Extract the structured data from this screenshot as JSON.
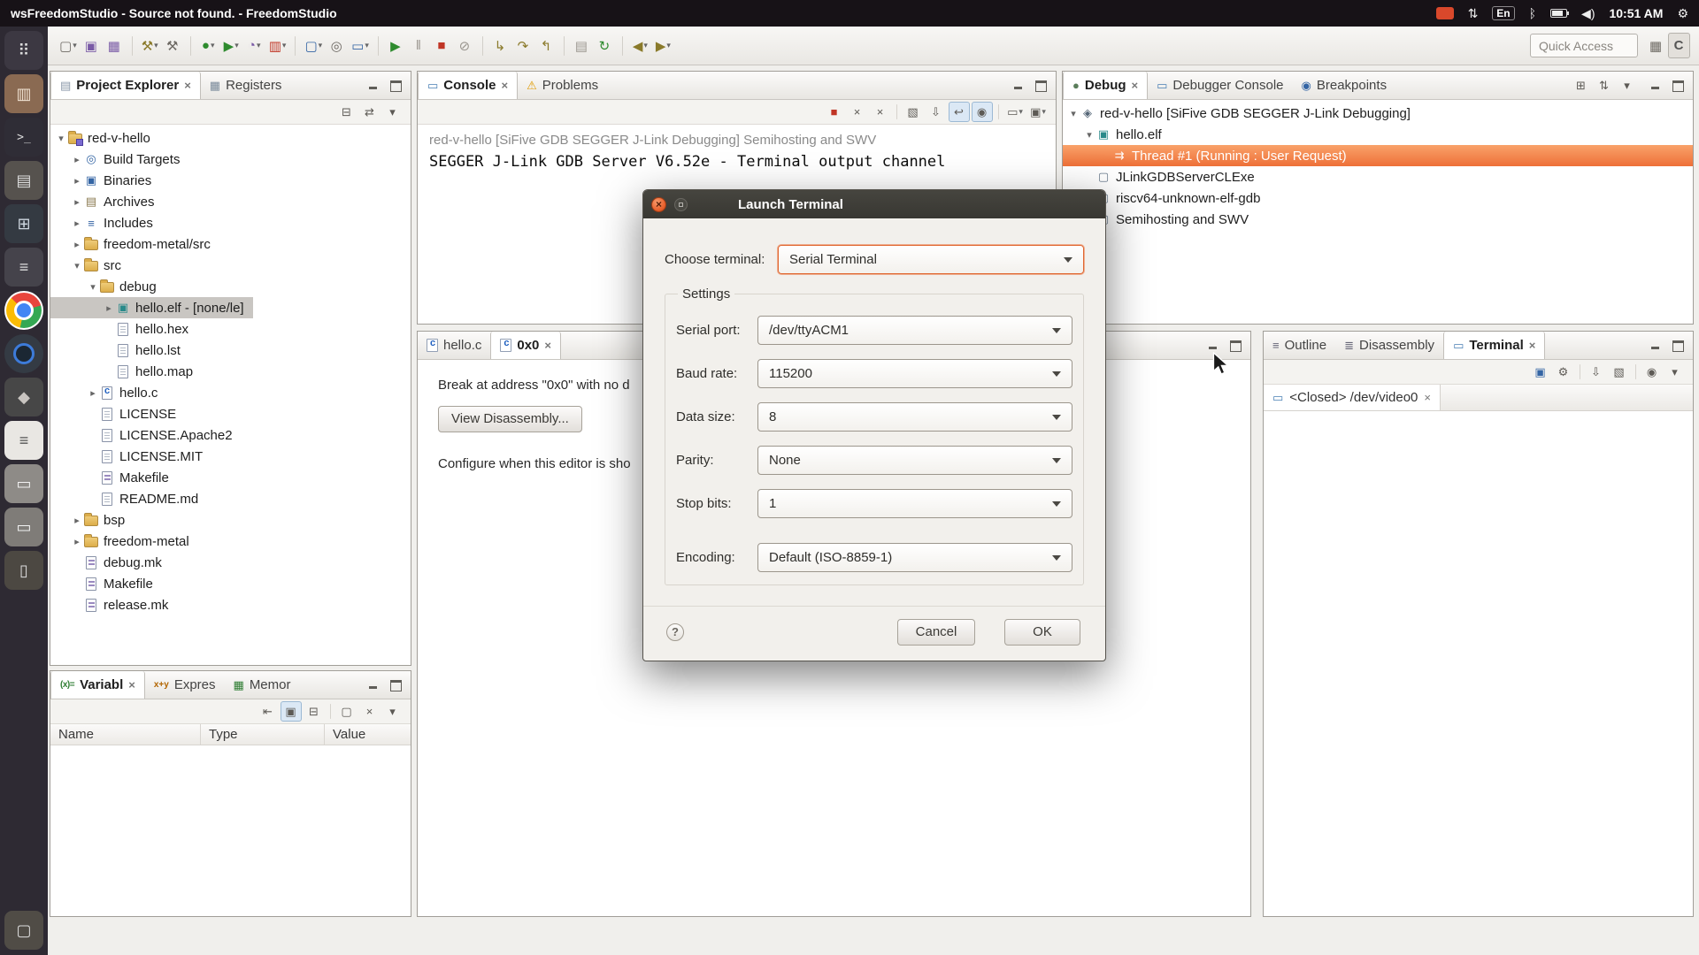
{
  "system_bar": {
    "title": "wsFreedomStudio - Source not found. - FreedomStudio",
    "language_indicator": "En",
    "time": "10:51 AM"
  },
  "dock": {
    "items": [
      {
        "name": "dash-icon",
        "glyph": "⠿",
        "mod": "dk-dash"
      },
      {
        "name": "files-icon",
        "glyph": "▥",
        "mod": "dk-files"
      },
      {
        "name": "terminal-icon",
        "glyph": ">_",
        "mod": "dk-term"
      },
      {
        "name": "archive-manager-icon",
        "glyph": "▤",
        "mod": "dk-arch"
      },
      {
        "name": "calculator-icon",
        "glyph": "⊞",
        "mod": "dk-calc"
      },
      {
        "name": "notes-icon",
        "glyph": "≡",
        "mod": "dk-note"
      },
      {
        "name": "chrome-icon",
        "glyph": "",
        "mod": "dk-chrome"
      },
      {
        "name": "camera-icon",
        "glyph": "",
        "mod": "dk-cam"
      },
      {
        "name": "gimp-icon",
        "glyph": "◆",
        "mod": "dk-gimp"
      },
      {
        "name": "freedomstudio-icon",
        "glyph": "≡",
        "mod": "dk-fs"
      },
      {
        "name": "drawer-icon",
        "glyph": "▭",
        "mod": "dk-gray1"
      },
      {
        "name": "drawer2-icon",
        "glyph": "▭",
        "mod": "dk-gray2"
      },
      {
        "name": "tablet-icon",
        "glyph": "▯",
        "mod": "dk-tab"
      },
      {
        "name": "trash-icon",
        "glyph": "▢",
        "mod": "dk-bottom"
      }
    ]
  },
  "toolbar": {
    "quick_access_label": "Quick Access",
    "buttons": [
      {
        "name": "new-button",
        "glyph": "▢",
        "dd": "▾",
        "mod": "c-gray"
      },
      {
        "name": "save-button",
        "glyph": "▣",
        "dd": "",
        "mod": "c-purple"
      },
      {
        "name": "save-all-button",
        "glyph": "▦",
        "dd": "",
        "mod": "c-purple"
      },
      {
        "mod": "sep"
      },
      {
        "name": "build-button",
        "glyph": "⚒",
        "dd": "▾",
        "mod": "c-olive"
      },
      {
        "name": "clean-build-button",
        "glyph": "⚒",
        "dd": "",
        "mod": "c-gray"
      },
      {
        "mod": "sep"
      },
      {
        "name": "debug-button",
        "glyph": "●",
        "dd": "▾",
        "mod": "c-green"
      },
      {
        "name": "run-button",
        "glyph": "▶",
        "dd": "▾",
        "mod": "c-green"
      },
      {
        "name": "profile-button",
        "glyph": "◔",
        "dd": "▾",
        "mod": "c-purple"
      },
      {
        "name": "coverage-button",
        "glyph": "▥",
        "dd": "▾",
        "mod": "c-red"
      },
      {
        "mod": "sep"
      },
      {
        "name": "new-c-file-button",
        "glyph": "▢",
        "dd": "▾",
        "mod": "c-blue"
      },
      {
        "name": "search-button",
        "glyph": "◎",
        "dd": "",
        "mod": "c-gray"
      },
      {
        "name": "open-terminal-button",
        "glyph": "▭",
        "dd": "▾",
        "mod": "c-blue"
      },
      {
        "mod": "sep"
      },
      {
        "name": "resume-button",
        "glyph": "▶",
        "dd": "",
        "mod": "c-green"
      },
      {
        "name": "suspend-button",
        "glyph": "‖",
        "dd": "",
        "mod": "c-dim"
      },
      {
        "name": "terminate-button",
        "glyph": "■",
        "dd": "",
        "mod": "c-red"
      },
      {
        "name": "disconnect-button",
        "glyph": "⊘",
        "dd": "",
        "mod": "c-dim"
      },
      {
        "mod": "sep"
      },
      {
        "name": "step-into-button",
        "glyph": "↳",
        "dd": "",
        "mod": "c-olive"
      },
      {
        "name": "step-over-button",
        "glyph": "↷",
        "dd": "",
        "mod": "c-olive"
      },
      {
        "name": "step-return-button",
        "glyph": "↰",
        "dd": "",
        "mod": "c-olive"
      },
      {
        "mod": "sep"
      },
      {
        "name": "instruction-stepping-button",
        "glyph": "▤",
        "dd": "",
        "mod": "c-dim"
      },
      {
        "name": "restart-button",
        "glyph": "↻",
        "dd": "",
        "mod": "c-green"
      },
      {
        "mod": "sep"
      },
      {
        "name": "back-button",
        "glyph": "◀",
        "dd": "▾",
        "mod": "c-olive"
      },
      {
        "name": "forward-button",
        "glyph": "▶",
        "dd": "▾",
        "mod": "c-olive"
      }
    ],
    "right_buttons": [
      {
        "name": "open-perspective-button",
        "glyph": "▦",
        "dd": "",
        "mod": "c-gray"
      },
      {
        "name": "c-cpp-perspective-button",
        "glyph": "C",
        "dd": "",
        "mod": "persp"
      }
    ]
  },
  "project_explorer": {
    "tabs": [
      {
        "name": "tab-project-explorer",
        "label": "Project Explorer",
        "mod": "active closable ti-pe"
      },
      {
        "name": "tab-registers",
        "label": "Registers",
        "mod": "ti-registers"
      }
    ],
    "toolbar": [
      {
        "name": "collapse-all-button",
        "glyph": "⊟",
        "dd": ""
      },
      {
        "name": "link-editor-button",
        "glyph": "⇄",
        "dd": ""
      },
      {
        "name": "view-menu-button",
        "glyph": "▾",
        "dd": ""
      }
    ],
    "tree": [
      {
        "name": "tree-item-red-v-hello",
        "label": "red-v-hello",
        "mod": "ind0 exp ic-project"
      },
      {
        "name": "tree-item-build-targets",
        "label": "Build Targets",
        "mod": "ind1 col ic-target"
      },
      {
        "name": "tree-item-binaries",
        "label": "Binaries",
        "mod": "ind1 col ic-bin"
      },
      {
        "name": "tree-item-archives",
        "label": "Archives",
        "mod": "ind1 col ic-archive"
      },
      {
        "name": "tree-item-includes",
        "label": "Includes",
        "mod": "ind1 col ic-includes"
      },
      {
        "name": "tree-item-freedom-metal-src",
        "label": "freedom-metal/src",
        "mod": "ind1 col ic-folder"
      },
      {
        "name": "tree-item-src",
        "label": "src",
        "mod": "ind1 exp ic-folder"
      },
      {
        "name": "tree-item-debug",
        "label": "debug",
        "mod": "ind2 exp ic-folder"
      },
      {
        "name": "tree-item-hello-elf",
        "label": "hello.elf - [none/le]",
        "mod": "ind3 col ic-elf sel"
      },
      {
        "name": "tree-item-hello-hex",
        "label": "hello.hex",
        "mod": "ind3 leaf ic-file"
      },
      {
        "name": "tree-item-hello-lst",
        "label": "hello.lst",
        "mod": "ind3 leaf ic-file"
      },
      {
        "name": "tree-item-hello-map",
        "label": "hello.map",
        "mod": "ind3 leaf ic-file"
      },
      {
        "name": "tree-item-hello-c",
        "label": "hello.c",
        "mod": "ind2 col ic-cfile"
      },
      {
        "name": "tree-item-license",
        "label": "LICENSE",
        "mod": "ind2 leaf ic-file"
      },
      {
        "name": "tree-item-license-apache2",
        "label": "LICENSE.Apache2",
        "mod": "ind2 leaf ic-file"
      },
      {
        "name": "tree-item-license-mit",
        "label": "LICENSE.MIT",
        "mod": "ind2 leaf ic-file"
      },
      {
        "name": "tree-item-makefile-src",
        "label": "Makefile",
        "mod": "ind2 leaf ic-make"
      },
      {
        "name": "tree-item-readme",
        "label": "README.md",
        "mod": "ind2 leaf ic-file"
      },
      {
        "name": "tree-item-bsp",
        "label": "bsp",
        "mod": "ind1 col ic-folder"
      },
      {
        "name": "tree-item-freedom-metal",
        "label": "freedom-metal",
        "mod": "ind1 col ic-folder"
      },
      {
        "name": "tree-item-debug-mk",
        "label": "debug.mk",
        "mod": "ind1 leaf ic-make"
      },
      {
        "name": "tree-item-makefile",
        "label": "Makefile",
        "mod": "ind1 leaf ic-make"
      },
      {
        "name": "tree-item-release-mk",
        "label": "release.mk",
        "mod": "ind1 leaf ic-make"
      }
    ]
  },
  "console": {
    "tabs": [
      {
        "name": "tab-console",
        "label": "Console",
        "mod": "active closable ti-console"
      },
      {
        "name": "tab-problems",
        "label": "Problems",
        "mod": "ti-problems"
      }
    ],
    "toolbar": [
      {
        "name": "stop-button",
        "glyph": "■",
        "dd": "",
        "mod": "c-red"
      },
      {
        "name": "close-console-button",
        "glyph": "×",
        "dd": ""
      },
      {
        "name": "close-all-consoles-button",
        "glyph": "×",
        "dd": ""
      },
      {
        "mod": "sep"
      },
      {
        "name": "clear-console-button",
        "glyph": "▧",
        "dd": ""
      },
      {
        "name": "scroll-lock-button",
        "glyph": "⇩",
        "dd": ""
      },
      {
        "name": "word-wrap-button",
        "glyph": "↩",
        "dd": "",
        "mod": "toggled"
      },
      {
        "name": "pin-console-button",
        "glyph": "◉",
        "dd": "",
        "mod": "toggled"
      },
      {
        "mod": "sep"
      },
      {
        "name": "display-selected-console-button",
        "glyph": "▭",
        "dd": "▾"
      },
      {
        "name": "open-console-button",
        "glyph": "▣",
        "dd": "▾"
      }
    ],
    "header": "red-v-hello [SiFive GDB SEGGER J-Link Debugging] Semihosting and SWV",
    "output": "SEGGER J-Link GDB Server V6.52e - Terminal output channel"
  },
  "editor": {
    "tabs": [
      {
        "name": "tab-hello-c",
        "label": "hello.c",
        "mod": "ti-cfile"
      },
      {
        "name": "tab-0x0",
        "label": "0x0",
        "mod": "active closable ti-cfile"
      }
    ],
    "message": "Break at address \"0x0\" with no d",
    "disassembly_button": "View Disassembly...",
    "note": "Configure when this editor is sho"
  },
  "debug": {
    "tabs": [
      {
        "name": "tab-debug",
        "label": "Debug",
        "mod": "active closable ti-debug"
      },
      {
        "name": "tab-debugger-console",
        "label": "Debugger Console",
        "mod": "ti-dbgconsole"
      },
      {
        "name": "tab-breakpoints",
        "label": "Breakpoints",
        "mod": "ti-breakpoints"
      }
    ],
    "toolbar": [
      {
        "name": "connect-button",
        "glyph": "⊞",
        "dd": ""
      },
      {
        "name": "updown-button",
        "glyph": "⇅",
        "dd": ""
      },
      {
        "name": "debug-view-menu-button",
        "glyph": "▾",
        "dd": ""
      }
    ],
    "tree": [
      {
        "name": "debug-item-launch",
        "label": "red-v-hello [SiFive GDB SEGGER J-Link Debugging]",
        "mod": "ind0 exp di-launch"
      },
      {
        "name": "debug-item-hello-elf",
        "label": "hello.elf",
        "mod": "ind1 exp di-elf"
      },
      {
        "name": "debug-item-thread-1",
        "label": "Thread #1 (Running : User Request)",
        "mod": "ind2 leaf di-thread selorange"
      },
      {
        "name": "debug-item-jlink",
        "label": "JLinkGDBServerCLExe",
        "mod": "ind1 leaf di-proc"
      },
      {
        "name": "debug-item-gdb",
        "label": "riscv64-unknown-elf-gdb",
        "mod": "ind1 leaf di-proc"
      },
      {
        "name": "debug-item-semihosting",
        "label": "Semihosting and SWV",
        "mod": "ind1 leaf di-proc"
      }
    ]
  },
  "right_panel": {
    "tabs": [
      {
        "name": "tab-outline",
        "label": "Outline",
        "mod": "ti-outline"
      },
      {
        "name": "tab-disassembly",
        "label": "Disassembly",
        "mod": "ti-disassembly"
      },
      {
        "name": "tab-terminal",
        "label": "Terminal",
        "mod": "active closable ti-terminal"
      }
    ],
    "toolbar": [
      {
        "name": "new-terminal-button",
        "glyph": "▣",
        "dd": "",
        "mod": "c-blue"
      },
      {
        "name": "terminal-settings-button",
        "glyph": "⚙",
        "dd": ""
      },
      {
        "mod": "sep"
      },
      {
        "name": "scroll-lock-terminal-button",
        "glyph": "⇩",
        "dd": ""
      },
      {
        "name": "clear-terminal-button",
        "glyph": "▧",
        "dd": ""
      },
      {
        "mod": "sep"
      },
      {
        "name": "pin-terminal-button",
        "glyph": "◉",
        "dd": ""
      },
      {
        "name": "terminal-view-menu-button",
        "glyph": "▾",
        "dd": ""
      }
    ],
    "terminal_tab": {
      "label": "<Closed> /dev/video0"
    }
  },
  "variables": {
    "tabs": [
      {
        "name": "tab-variables",
        "label": "Variabl",
        "mod": "active closable ti-variables"
      },
      {
        "name": "tab-expressions",
        "label": "Expres",
        "mod": "ti-expressions"
      },
      {
        "name": "tab-memory",
        "label": "Memor",
        "mod": "ti-memory"
      }
    ],
    "toolbar": [
      {
        "name": "show-type-names-button",
        "glyph": "⇤",
        "dd": ""
      },
      {
        "name": "show-logical-structure-button",
        "glyph": "▣",
        "dd": "",
        "mod": "toggled"
      },
      {
        "name": "collapse-all-variables-button",
        "glyph": "⊟",
        "dd": ""
      },
      {
        "mod": "sep"
      },
      {
        "name": "add-watch-button",
        "glyph": "▢",
        "dd": ""
      },
      {
        "name": "remove-watch-button",
        "glyph": "×",
        "dd": ""
      },
      {
        "name": "variables-view-menu-button",
        "glyph": "▾",
        "dd": ""
      }
    ],
    "columns": [
      {
        "label": "Name"
      },
      {
        "label": "Type"
      },
      {
        "label": "Value"
      }
    ]
  },
  "dialog": {
    "title": "Launch Terminal",
    "choose_label": "Choose terminal:",
    "choose_value": "Serial Terminal",
    "settings_label": "Settings",
    "fields": [
      {
        "name": "serial-port-row",
        "label": "Serial port:",
        "value": "/dev/ttyACM1"
      },
      {
        "name": "baud-rate-row",
        "label": "Baud rate:",
        "value": "115200"
      },
      {
        "name": "data-size-row",
        "label": "Data size:",
        "value": "8"
      },
      {
        "name": "parity-row",
        "label": "Parity:",
        "value": "None"
      },
      {
        "name": "stop-bits-row",
        "label": "Stop bits:",
        "value": "1"
      },
      {
        "name": "encoding-row",
        "label": "Encoding:",
        "value": "Default (ISO-8859-1)",
        "mod": "gap"
      }
    ],
    "help_label": "?",
    "cancel_label": "Cancel",
    "ok_label": "OK"
  }
}
